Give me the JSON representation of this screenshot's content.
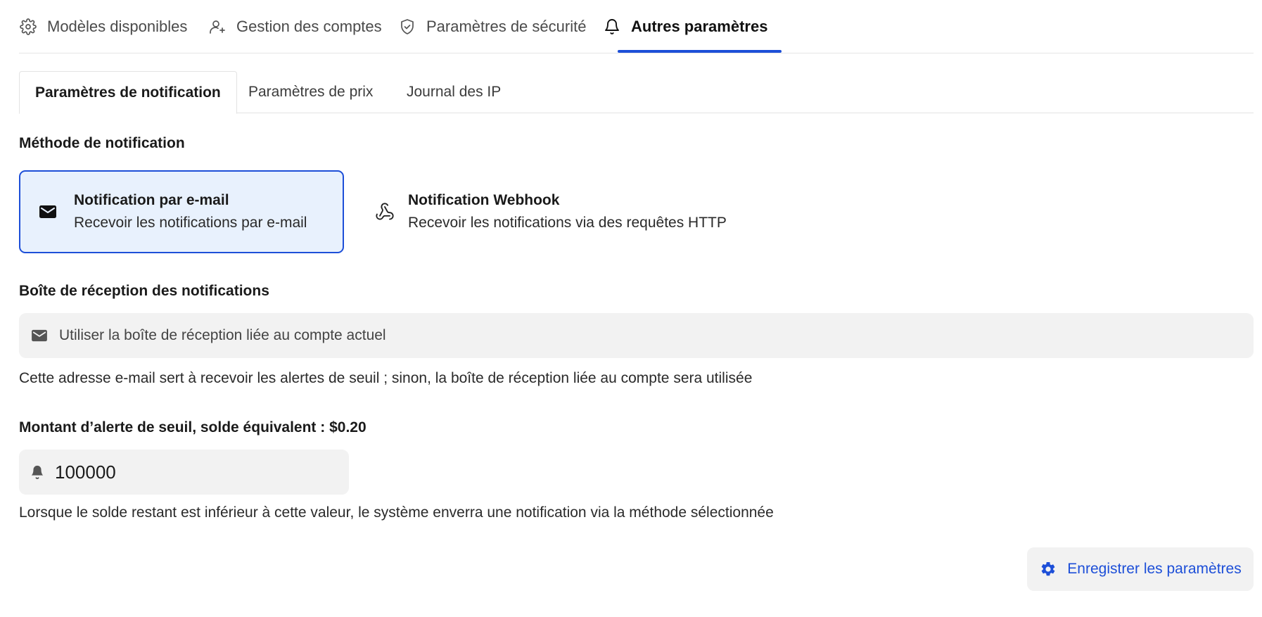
{
  "top_tabs": [
    {
      "label": "Modèles disponibles",
      "icon": "gear-icon",
      "active": false
    },
    {
      "label": "Gestion des comptes",
      "icon": "user-plus-icon",
      "active": false
    },
    {
      "label": "Paramètres de sécurité",
      "icon": "shield-icon",
      "active": false
    },
    {
      "label": "Autres paramètres",
      "icon": "bell-icon",
      "active": true
    }
  ],
  "sub_tabs": [
    {
      "label": "Paramètres de notification",
      "active": true
    },
    {
      "label": "Paramètres de prix",
      "active": false
    },
    {
      "label": "Journal des IP",
      "active": false
    }
  ],
  "notification_method": {
    "label": "Méthode de notification",
    "options": [
      {
        "title": "Notification par e-mail",
        "description": "Recevoir les notifications par e-mail",
        "icon": "mail-icon",
        "selected": true
      },
      {
        "title": "Notification Webhook",
        "description": "Recevoir les notifications via des requêtes HTTP",
        "icon": "webhook-icon",
        "selected": false
      }
    ]
  },
  "inbox": {
    "label": "Boîte de réception des notifications",
    "placeholder": "Utiliser la boîte de réception liée au compte actuel",
    "value": "",
    "help": "Cette adresse e-mail sert à recevoir les alertes de seuil ; sinon, la boîte de réception liée au compte sera utilisée"
  },
  "threshold": {
    "label": "Montant d’alerte de seuil, solde équivalent : $0.20",
    "value": "100000",
    "help": "Lorsque le solde restant est inférieur à cette valeur, le système enverra une notification via la méthode sélectionnée"
  },
  "save_button": {
    "label": "Enregistrer les paramètres",
    "icon": "gear-icon"
  },
  "colors": {
    "accent": "#1d4fd8",
    "selected_bg": "#e8f1fd",
    "field_bg": "#f2f2f2"
  }
}
